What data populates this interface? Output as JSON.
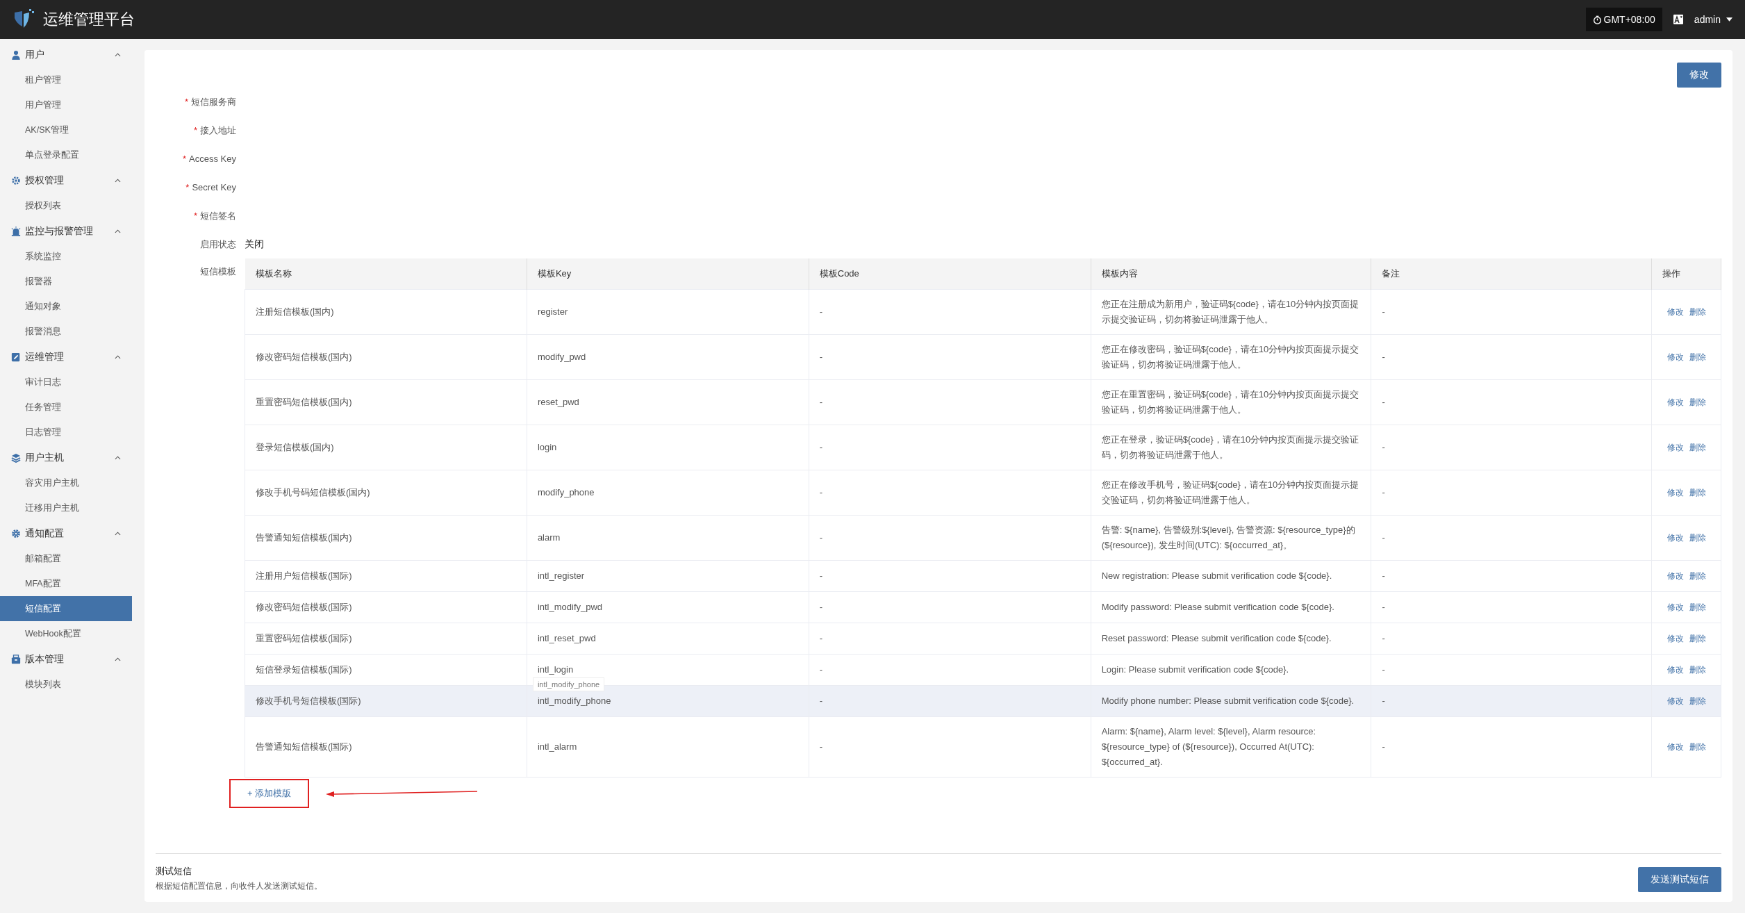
{
  "header": {
    "title": "运维管理平台",
    "timezone": "GMT+08:00",
    "user": "admin"
  },
  "sidebar": {
    "groups": [
      {
        "label": "用户",
        "expanded": true,
        "items": [
          {
            "label": "租户管理",
            "selected": false
          },
          {
            "label": "用户管理",
            "selected": false
          },
          {
            "label": "AK/SK管理",
            "selected": false
          },
          {
            "label": "单点登录配置",
            "selected": false
          }
        ]
      },
      {
        "label": "授权管理",
        "expanded": true,
        "items": [
          {
            "label": "授权列表",
            "selected": false
          }
        ]
      },
      {
        "label": "监控与报警管理",
        "expanded": true,
        "items": [
          {
            "label": "系统监控",
            "selected": false
          },
          {
            "label": "报警器",
            "selected": false
          },
          {
            "label": "通知对象",
            "selected": false
          },
          {
            "label": "报警消息",
            "selected": false
          }
        ]
      },
      {
        "label": "运维管理",
        "expanded": true,
        "items": [
          {
            "label": "审计日志",
            "selected": false
          },
          {
            "label": "任务管理",
            "selected": false
          },
          {
            "label": "日志管理",
            "selected": false
          }
        ]
      },
      {
        "label": "用户主机",
        "expanded": true,
        "items": [
          {
            "label": "容灾用户主机",
            "selected": false
          },
          {
            "label": "迁移用户主机",
            "selected": false
          }
        ]
      },
      {
        "label": "通知配置",
        "expanded": true,
        "items": [
          {
            "label": "邮箱配置",
            "selected": false
          },
          {
            "label": "MFA配置",
            "selected": false
          },
          {
            "label": "短信配置",
            "selected": true
          },
          {
            "label": "WebHook配置",
            "selected": false
          }
        ]
      },
      {
        "label": "版本管理",
        "expanded": true,
        "items": [
          {
            "label": "模块列表",
            "selected": false
          }
        ]
      }
    ]
  },
  "edit_button": "修改",
  "form": {
    "fields": [
      {
        "label": "短信服务商",
        "marker": "*"
      },
      {
        "label": "接入地址",
        "marker": "*"
      },
      {
        "label": "Access Key",
        "marker": "*"
      },
      {
        "label": "Secret Key",
        "marker": "*"
      },
      {
        "label": "短信签名",
        "marker": "*"
      },
      {
        "label": "启用状态",
        "value": "关闭"
      }
    ],
    "templates_label": "短信模板"
  },
  "table": {
    "columns": [
      "模板名称",
      "模板Key",
      "模板Code",
      "模板内容",
      "备注",
      "操作"
    ],
    "rows": [
      {
        "name": "注册短信模板(国内)",
        "key": "register",
        "code": "-",
        "content": "您正在注册成为新用户，验证码${code}，请在10分钟内按页面提示提交验证码，切勿将验证码泄露于他人。",
        "remark": "-",
        "hovered": false,
        "actions": [
          "修改",
          "删除"
        ]
      },
      {
        "name": "修改密码短信模板(国内)",
        "key": "modify_pwd",
        "code": "-",
        "content": "您正在修改密码，验证码${code}，请在10分钟内按页面提示提交验证码，切勿将验证码泄露于他人。",
        "remark": "-",
        "hovered": false,
        "actions": [
          "修改",
          "删除"
        ]
      },
      {
        "name": "重置密码短信模板(国内)",
        "key": "reset_pwd",
        "code": "-",
        "content": "您正在重置密码，验证码${code}，请在10分钟内按页面提示提交验证码，切勿将验证码泄露于他人。",
        "remark": "-",
        "hovered": false,
        "actions": [
          "修改",
          "删除"
        ]
      },
      {
        "name": "登录短信模板(国内)",
        "key": "login",
        "code": "-",
        "content": "您正在登录，验证码${code}，请在10分钟内按页面提示提交验证码，切勿将验证码泄露于他人。",
        "remark": "-",
        "hovered": false,
        "actions": [
          "修改",
          "删除"
        ]
      },
      {
        "name": "修改手机号码短信模板(国内)",
        "key": "modify_phone",
        "code": "-",
        "content": "您正在修改手机号，验证码${code}，请在10分钟内按页面提示提交验证码，切勿将验证码泄露于他人。",
        "remark": "-",
        "hovered": false,
        "actions": [
          "修改",
          "删除"
        ]
      },
      {
        "name": "告警通知短信模板(国内)",
        "key": "alarm",
        "code": "-",
        "content": "告警: ${name}, 告警级别:${level}, 告警资源: ${resource_type}的(${resource}), 发生时间(UTC): ${occurred_at}。",
        "remark": "-",
        "hovered": false,
        "actions": [
          "修改",
          "删除"
        ]
      },
      {
        "name": "注册用户短信模板(国际)",
        "key": "intl_register",
        "code": "-",
        "content": "New registration: Please submit verification code ${code}.",
        "remark": "-",
        "hovered": false,
        "actions": [
          "修改",
          "删除"
        ]
      },
      {
        "name": "修改密码短信模板(国际)",
        "key": "intl_modify_pwd",
        "code": "-",
        "content": "Modify password: Please submit verification code ${code}.",
        "remark": "-",
        "hovered": false,
        "actions": [
          "修改",
          "删除"
        ]
      },
      {
        "name": "重置密码短信模板(国际)",
        "key": "intl_reset_pwd",
        "code": "-",
        "content": "Reset password: Please submit verification code ${code}.",
        "remark": "-",
        "hovered": false,
        "actions": [
          "修改",
          "删除"
        ]
      },
      {
        "name": "短信登录短信模板(国际)",
        "key": "intl_login",
        "code": "-",
        "content": "Login: Please submit verification code ${code}.",
        "remark": "-",
        "hovered": false,
        "actions": [
          "修改",
          "删除"
        ]
      },
      {
        "name": "修改手机号短信模板(国际)",
        "key": "intl_modify_phone",
        "code": "-",
        "content": "Modify phone number: Please submit verification code ${code}.",
        "remark": "-",
        "hovered": true,
        "tooltip": "intl_modify_phone",
        "actions": [
          "修改",
          "删除"
        ]
      },
      {
        "name": "告警通知短信模板(国际)",
        "key": "intl_alarm",
        "code": "-",
        "content": "Alarm: ${name}, Alarm level: ${level}, Alarm resource: ${resource_type} of (${resource}), Occurred At(UTC): ${occurred_at}.",
        "remark": "-",
        "hovered": false,
        "actions": [
          "修改",
          "删除"
        ]
      }
    ]
  },
  "add_template": {
    "label": "+ 添加模版",
    "highlighted": true
  },
  "test_sms": {
    "title": "测试短信",
    "description": "根据短信配置信息，向收件人发送测试短信。",
    "button": "发送测试短信"
  }
}
